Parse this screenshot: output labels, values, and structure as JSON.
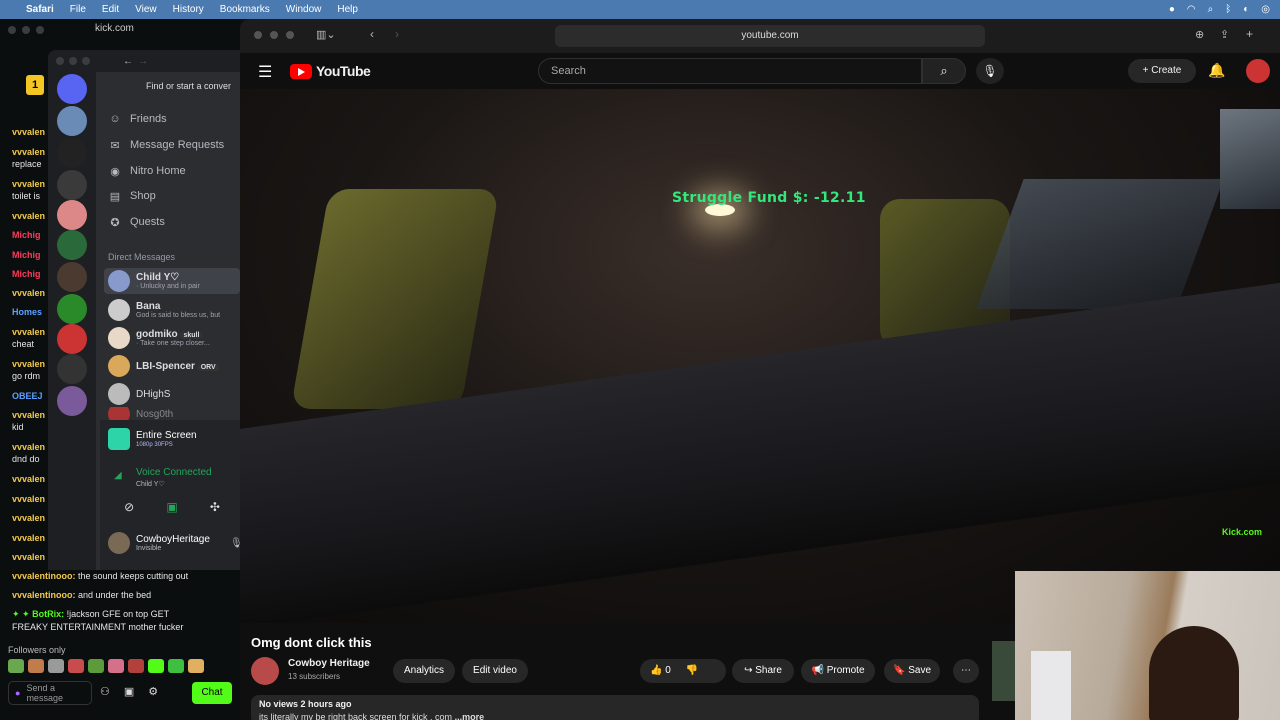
{
  "menubar": {
    "app": "Safari",
    "items": [
      "File",
      "Edit",
      "View",
      "History",
      "Bookmarks",
      "Window",
      "Help"
    ]
  },
  "kick": {
    "url": "kick.com",
    "badge": "1",
    "chat_users": [
      "vvvalen",
      "vvvalen",
      "vvvalen",
      "vvvalen",
      "Michig",
      "Michig",
      "Michig",
      "vvvalen",
      "Homes",
      "vvvalen",
      "vvvalen",
      "OBEEJ",
      "vvvalen",
      "vvvalen",
      "vvvalen",
      "vvvalen",
      "vvvalen",
      "vvvalen"
    ],
    "chat_fragments": [
      "replace",
      "toilet is",
      "cheat",
      "go rdm",
      "kid",
      "dnd do"
    ],
    "msg1_user": "vvvalentinooo:",
    "msg1_text": "the sound keeps cutting out",
    "msg2_user": "vvvalentinooo:",
    "msg2_text": "and under the bed",
    "msg3_user": "BotRix:",
    "msg3_text": "!jackson GFE on top GET",
    "msg3_text2": "FREAKY ENTERTAINMENT mother fucker",
    "followers": "Followers only",
    "send_placeholder": "Send a message",
    "chat_button": "Chat",
    "brand_color": "#53fc18"
  },
  "discord": {
    "search": "Find or start a conver",
    "nav": [
      "Friends",
      "Message Requests",
      "Nitro Home",
      "Shop",
      "Quests"
    ],
    "dm_header": "Direct Messages",
    "dms": [
      {
        "name": "Child Y♡",
        "status": "· Unlucky and in pair"
      },
      {
        "name": "Bana",
        "status": "God is said to bless us, but"
      },
      {
        "name": "godmiko",
        "status": "· Take one step closer..."
      },
      {
        "name": "LBI-Spencer",
        "status": ""
      },
      {
        "name": "DHighS",
        "status": ""
      },
      {
        "name": "Nosg0th",
        "status": ""
      }
    ],
    "dm_tags": {
      "godmiko": "skull",
      "spencer": "ORV"
    },
    "share_title": "Entire Screen",
    "share_sub": "1080p 30FPS",
    "voice": "Voice Connected",
    "voice_sub": "Child Y♡",
    "user_name": "CowboyHeritage",
    "user_status": "Invisible"
  },
  "youtube": {
    "address": "youtube.com",
    "logo": "YouTube",
    "search_placeholder": "Search",
    "create": "Create",
    "overlay_text": "Struggle Fund $: -12.11",
    "watermark": "Kick.com",
    "title": "Omg dont click this",
    "channel": "Cowboy Heritage",
    "subs": "13 subscribers",
    "analytics": "Analytics",
    "edit": "Edit video",
    "likes": "0",
    "share": "Share",
    "promote": "Promote",
    "save": "Save",
    "views": "No views  2 hours ago",
    "desc_line": "its literally my be right back screen for kick . com",
    "more": "...more"
  }
}
